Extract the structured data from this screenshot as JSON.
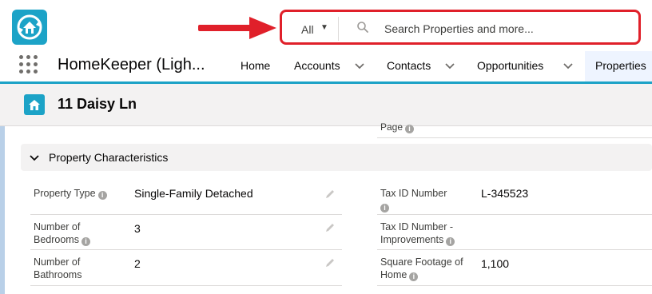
{
  "search": {
    "scope_label": "All",
    "placeholder": "Search Properties and more..."
  },
  "nav": {
    "app_name": "HomeKeeper (Ligh...",
    "items": [
      {
        "label": "Home"
      },
      {
        "label": "Accounts"
      },
      {
        "label": "Contacts"
      },
      {
        "label": "Opportunities"
      },
      {
        "label": "Properties"
      }
    ]
  },
  "record": {
    "title": "11 Daisy Ln"
  },
  "page_fragment": "Page",
  "section": {
    "title": "Property Characteristics"
  },
  "fields_left": [
    {
      "label": "Property Type",
      "value": "Single-Family Detached"
    },
    {
      "label_line1": "Number of",
      "label_line2": "Bedrooms",
      "value": "3"
    },
    {
      "label_line1": "Number of",
      "label_line2": "Bathrooms",
      "value": "2"
    }
  ],
  "fields_right": [
    {
      "label": "Tax ID Number",
      "value": "L-345523"
    },
    {
      "label_line1": "Tax ID Number -",
      "label_line2": "Improvements",
      "value": ""
    },
    {
      "label_line1": "Square Footage of",
      "label_line2": "Home",
      "value": "1,100"
    }
  ],
  "colors": {
    "brand": "#1ca3c7",
    "annotation_red": "#e0202a"
  },
  "icons": {
    "app_logo": "home-sync-icon",
    "record": "home-icon",
    "search": "search-icon",
    "info": "info-icon",
    "edit": "pencil-icon"
  }
}
